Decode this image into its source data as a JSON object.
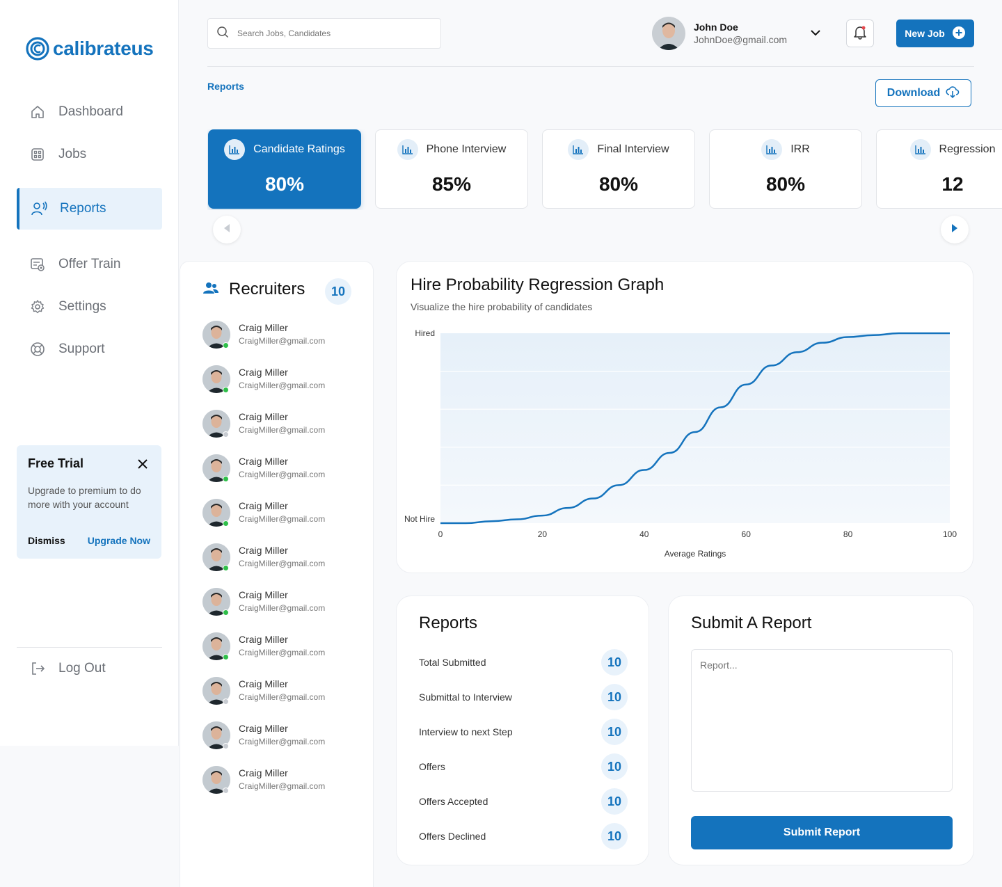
{
  "brand": {
    "name": "calibrateus",
    "accent": "#1473bd"
  },
  "sidebar": {
    "items": [
      {
        "label": "Dashboard",
        "icon": "home-icon"
      },
      {
        "label": "Jobs",
        "icon": "grid-icon"
      },
      {
        "label": "Reports",
        "icon": "reports-icon",
        "active": true
      },
      {
        "label": "Offer Train",
        "icon": "offer-icon"
      },
      {
        "label": "Settings",
        "icon": "gear-icon"
      },
      {
        "label": "Support",
        "icon": "lifebuoy-icon"
      }
    ],
    "logout_label": "Log Out"
  },
  "trial": {
    "title": "Free Trial",
    "text": "Upgrade to premium to do more with your account",
    "dismiss": "Dismiss",
    "upgrade": "Upgrade Now"
  },
  "header": {
    "search_placeholder": "Search Jobs, Candidates",
    "user_name": "John Doe",
    "user_email": "JohnDoe@gmail.com",
    "new_job": "New Job"
  },
  "page": {
    "breadcrumb": "Reports",
    "download": "Download"
  },
  "stats": [
    {
      "label": "Candidate Ratings",
      "value": "80%",
      "active": true
    },
    {
      "label": "Phone Interview",
      "value": "85%"
    },
    {
      "label": "Final Interview",
      "value": "80%"
    },
    {
      "label": "IRR",
      "value": "80%"
    },
    {
      "label": "Regression",
      "value": "12"
    }
  ],
  "recruiters": {
    "title": "Recruiters",
    "count": "10",
    "items": [
      {
        "name": "Craig Miller",
        "email": "CraigMiller@gmail.com",
        "online": true
      },
      {
        "name": "Craig Miller",
        "email": "CraigMiller@gmail.com",
        "online": true
      },
      {
        "name": "Craig Miller",
        "email": "CraigMiller@gmail.com",
        "online": false
      },
      {
        "name": "Craig Miller",
        "email": "CraigMiller@gmail.com",
        "online": true
      },
      {
        "name": "Craig Miller",
        "email": "CraigMiller@gmail.com",
        "online": true
      },
      {
        "name": "Craig Miller",
        "email": "CraigMiller@gmail.com",
        "online": true
      },
      {
        "name": "Craig Miller",
        "email": "CraigMiller@gmail.com",
        "online": true
      },
      {
        "name": "Craig Miller",
        "email": "CraigMiller@gmail.com",
        "online": true
      },
      {
        "name": "Craig Miller",
        "email": "CraigMiller@gmail.com",
        "online": false
      },
      {
        "name": "Craig Miller",
        "email": "CraigMiller@gmail.com",
        "online": false
      },
      {
        "name": "Craig Miller",
        "email": "CraigMiller@gmail.com",
        "online": false
      }
    ]
  },
  "graph": {
    "title": "Hire Probability Regression Graph",
    "subtitle": "Visualize the hire probability of candidates"
  },
  "chart_data": {
    "type": "line",
    "title": "Hire Probability Regression Graph",
    "subtitle": "Visualize the hire probability of candidates",
    "xlabel": "Average Ratings",
    "ylabel": "",
    "xlim": [
      0,
      100
    ],
    "ylim": [
      0,
      1
    ],
    "x_ticks": [
      "0",
      "20",
      "40",
      "60",
      "80",
      "100"
    ],
    "y_ticks": [
      "Not Hire",
      "Hired"
    ],
    "grid": true,
    "series": [
      {
        "x": [
          0,
          5,
          10,
          15,
          20,
          25,
          30,
          35,
          40,
          45,
          50,
          55,
          60,
          65,
          70,
          75,
          80,
          85,
          90,
          95,
          100
        ],
        "y": [
          0.0,
          0.0,
          0.01,
          0.02,
          0.04,
          0.08,
          0.13,
          0.2,
          0.28,
          0.37,
          0.48,
          0.61,
          0.73,
          0.83,
          0.9,
          0.95,
          0.98,
          0.99,
          1.0,
          1.0,
          1.0
        ]
      }
    ]
  },
  "reports_card": {
    "title": "Reports",
    "rows": [
      {
        "label": "Total Submitted",
        "value": "10"
      },
      {
        "label": "Submittal to Interview",
        "value": "10"
      },
      {
        "label": "Interview to next Step",
        "value": "10"
      },
      {
        "label": "Offers",
        "value": "10"
      },
      {
        "label": "Offers Accepted",
        "value": "10"
      },
      {
        "label": "Offers Declined",
        "value": "10"
      }
    ]
  },
  "submit_card": {
    "title": "Submit A Report",
    "placeholder": "Report...",
    "button": "Submit Report"
  }
}
